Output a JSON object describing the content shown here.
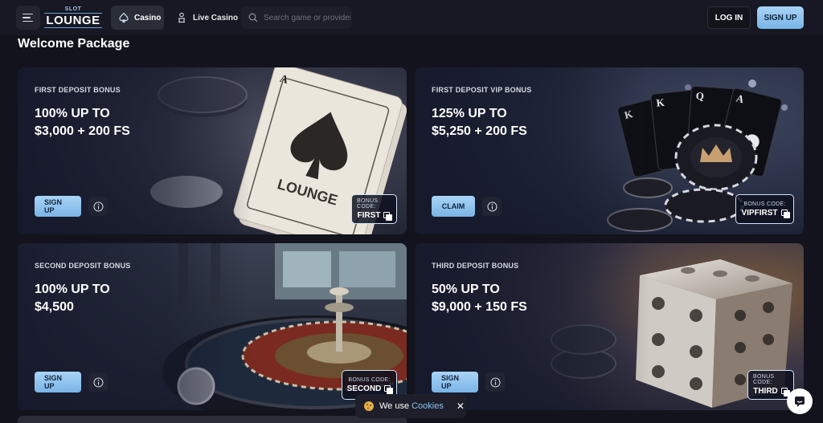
{
  "header": {
    "logo_top": "SLOT",
    "logo_main": "LOUNGE",
    "nav": {
      "casino": "Casino",
      "live_casino": "Live Casino"
    },
    "search_placeholder": "Search game or provider",
    "login_label": "LOG IN",
    "signup_label": "SIGN UP"
  },
  "page_title": "Welcome Package",
  "cards": [
    {
      "label": "FIRST DEPOSIT BONUS",
      "headline": "100% UP TO\n$3,000 + 200 FS",
      "cta": "SIGN UP",
      "bonus_code_label": "BONUS CODE:",
      "bonus_code": "FIRST",
      "art": "playing-cards"
    },
    {
      "label": "FIRST DEPOSIT VIP BONUS",
      "headline": "125% UP TO\n$5,250 + 200 FS",
      "cta": "CLAIM",
      "bonus_code_label": "BONUS CODE:",
      "bonus_code": "VIPFIRST",
      "art": "vip-cards-chip"
    },
    {
      "label": "SECOND DEPOSIT BONUS",
      "headline": "100% UP TO\n$4,500",
      "cta": "SIGN UP",
      "bonus_code_label": "BONUS CODE:",
      "bonus_code": "SECOND",
      "art": "roulette"
    },
    {
      "label": "THIRD DEPOSIT BONUS",
      "headline": "50% UP TO\n$9,000 + 150 FS",
      "cta": "SIGN UP",
      "bonus_code_label": "BONUS CODE:",
      "bonus_code": "THIRD",
      "art": "dice"
    }
  ],
  "cookie_bar": {
    "text": "We use",
    "link": "Cookies",
    "close": "✕"
  },
  "icons": {
    "menu": "menu-icon",
    "casino": "spade-icon",
    "live": "dealer-icon",
    "search": "search-icon",
    "info": "info-icon",
    "copy": "copy-icon",
    "cookie": "cookie-icon",
    "chat": "chat-icon"
  },
  "colors": {
    "accent": "#8cc3f2",
    "background": "#12131c",
    "header": "#171823"
  }
}
